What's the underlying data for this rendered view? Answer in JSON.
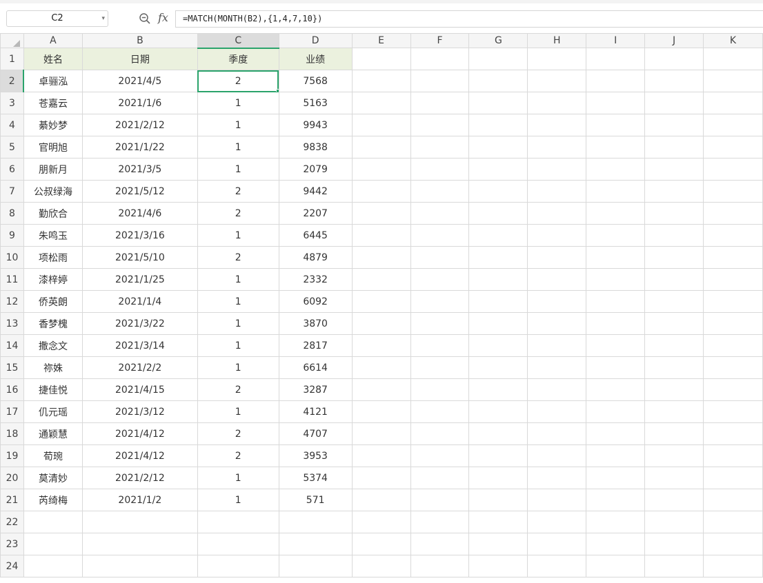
{
  "formula_bar": {
    "name_box": "C2",
    "formula": "=MATCH(MONTH(B2),{1,4,7,10})",
    "zoom_icon": "zoom-out-icon",
    "fx_label": "fx"
  },
  "columns": [
    "A",
    "B",
    "C",
    "D",
    "E",
    "F",
    "G",
    "H",
    "I",
    "J",
    "K"
  ],
  "header_row": [
    "姓名",
    "日期",
    "季度",
    "业绩"
  ],
  "rows": [
    [
      "卓骊泓",
      "2021/4/5",
      "2",
      "7568"
    ],
    [
      "苍嘉云",
      "2021/1/6",
      "1",
      "5163"
    ],
    [
      "綦妙梦",
      "2021/2/12",
      "1",
      "9943"
    ],
    [
      "官明旭",
      "2021/1/22",
      "1",
      "9838"
    ],
    [
      "朋新月",
      "2021/3/5",
      "1",
      "2079"
    ],
    [
      "公叔绿海",
      "2021/5/12",
      "2",
      "9442"
    ],
    [
      "勤欣合",
      "2021/4/6",
      "2",
      "2207"
    ],
    [
      "朱鸣玉",
      "2021/3/16",
      "1",
      "6445"
    ],
    [
      "项松雨",
      "2021/5/10",
      "2",
      "4879"
    ],
    [
      "漆梓婷",
      "2021/1/25",
      "1",
      "2332"
    ],
    [
      "侨英朗",
      "2021/1/4",
      "1",
      "6092"
    ],
    [
      "香梦槐",
      "2021/3/22",
      "1",
      "3870"
    ],
    [
      "撒念文",
      "2021/3/14",
      "1",
      "2817"
    ],
    [
      "祢姝",
      "2021/2/2",
      "1",
      "6614"
    ],
    [
      "捷佳悦",
      "2021/4/15",
      "2",
      "3287"
    ],
    [
      "仉元瑶",
      "2021/3/12",
      "1",
      "4121"
    ],
    [
      "通颖慧",
      "2021/4/12",
      "2",
      "4707"
    ],
    [
      "荀琬",
      "2021/4/12",
      "2",
      "3953"
    ],
    [
      "莫清妙",
      "2021/2/12",
      "1",
      "5374"
    ],
    [
      "芮绮梅",
      "2021/1/2",
      "1",
      "571"
    ]
  ],
  "row_numbers": [
    "1",
    "2",
    "3",
    "4",
    "5",
    "6",
    "7",
    "8",
    "9",
    "10",
    "11",
    "12",
    "13",
    "14",
    "15",
    "16",
    "17",
    "18",
    "19",
    "20",
    "21",
    "22",
    "23",
    "24"
  ],
  "colors": {
    "header_fill": "#ebf1de",
    "selection": "#2aa36b"
  }
}
